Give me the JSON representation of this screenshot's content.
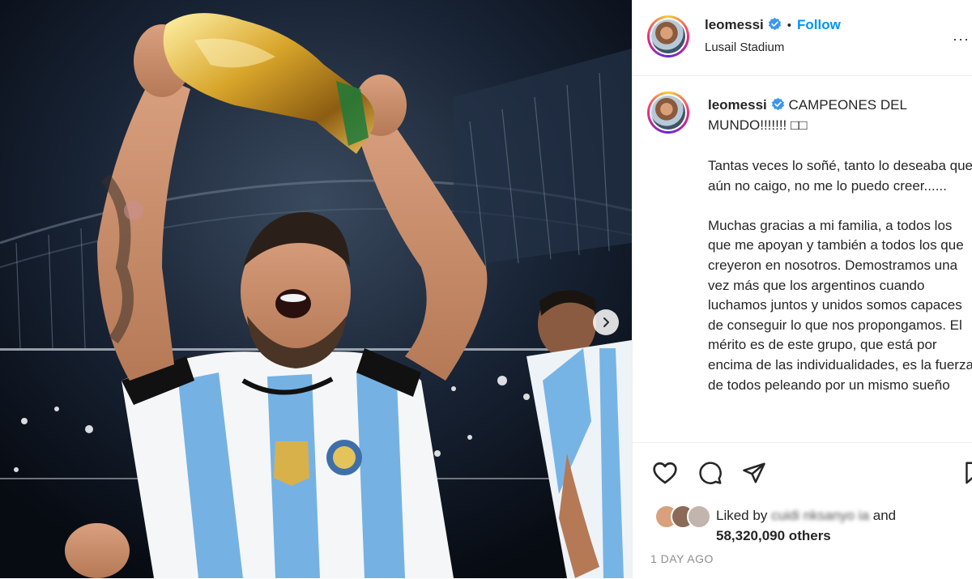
{
  "post": {
    "username": "leomessi",
    "follow_label": "Follow",
    "dot": "•",
    "location": "Lusail Stadium",
    "more_label": "···"
  },
  "caption": {
    "username": "leomessi",
    "headline": "CAMPEONES DEL MUNDO!!!!!!! □□",
    "paragraph1": "Tantas veces lo soñé, tanto lo deseaba que aún no caigo, no me lo puedo creer......",
    "paragraph2": "Muchas gracias a mi familia, a todos los que me apoyan y también a todos los que creyeron en nosotros. Demostramos una vez más que los argentinos cuando luchamos juntos y unidos somos capaces de conseguir lo que nos propongamos. El mérito es de este grupo, que está por encima de las individualidades, es la fuerza de todos peleando por un mismo sueño"
  },
  "likes": {
    "liked_by_label": "Liked by",
    "liked_user": "cuidi nksanyo ia",
    "and_label": "and",
    "others": "58,320,090 others"
  },
  "date": "1 DAY AGO",
  "icons": {
    "like": "heart-icon",
    "comment": "comment-icon",
    "share": "send-icon",
    "save": "bookmark-icon",
    "verified": "verified-badge-icon",
    "next": "chevron-right-icon"
  },
  "colors": {
    "accent": "#0095f6",
    "verified": "#3897f0",
    "muted": "#8e8e8e"
  }
}
